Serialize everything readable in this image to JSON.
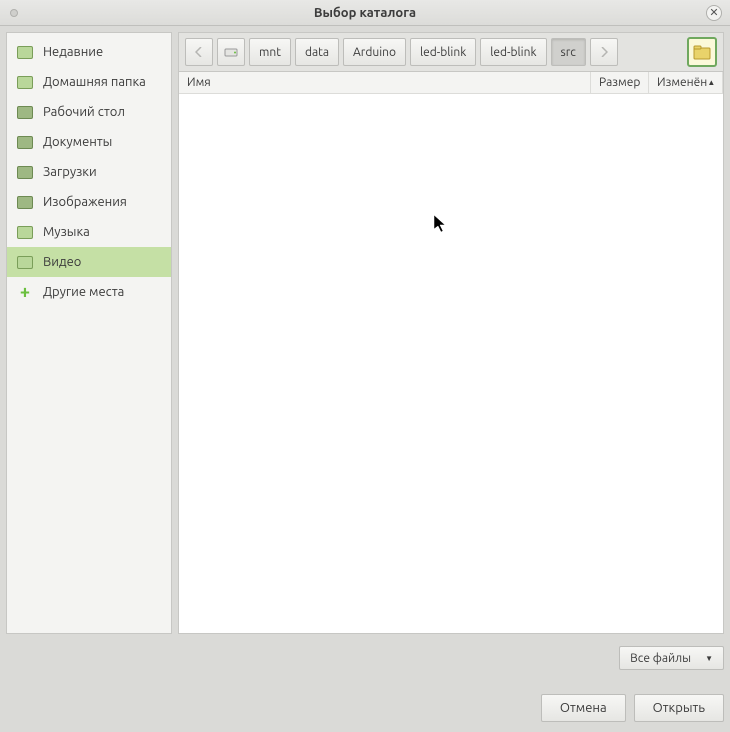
{
  "titlebar": {
    "title": "Выбор каталога"
  },
  "sidebar": {
    "items": [
      {
        "label": "Недавние",
        "icon": "folder"
      },
      {
        "label": "Домашняя папка",
        "icon": "folder"
      },
      {
        "label": "Рабочий стол",
        "icon": "camera"
      },
      {
        "label": "Документы",
        "icon": "camera"
      },
      {
        "label": "Загрузки",
        "icon": "camera"
      },
      {
        "label": "Изображения",
        "icon": "camera"
      },
      {
        "label": "Музыка",
        "icon": "folder"
      },
      {
        "label": "Видео",
        "icon": "folder",
        "selected": true
      },
      {
        "label": "Другие места",
        "icon": "plus"
      }
    ]
  },
  "path": {
    "segments": [
      "mnt",
      "data",
      "Arduino",
      "led-blink",
      "led-blink",
      "src"
    ],
    "active_index": 5
  },
  "columns": {
    "name": "Имя",
    "size": "Размер",
    "modified": "Изменён",
    "sort_col": "modified",
    "sort_dir": "asc"
  },
  "filter": {
    "label": "Все файлы"
  },
  "buttons": {
    "cancel": "Отмена",
    "open": "Открыть"
  }
}
